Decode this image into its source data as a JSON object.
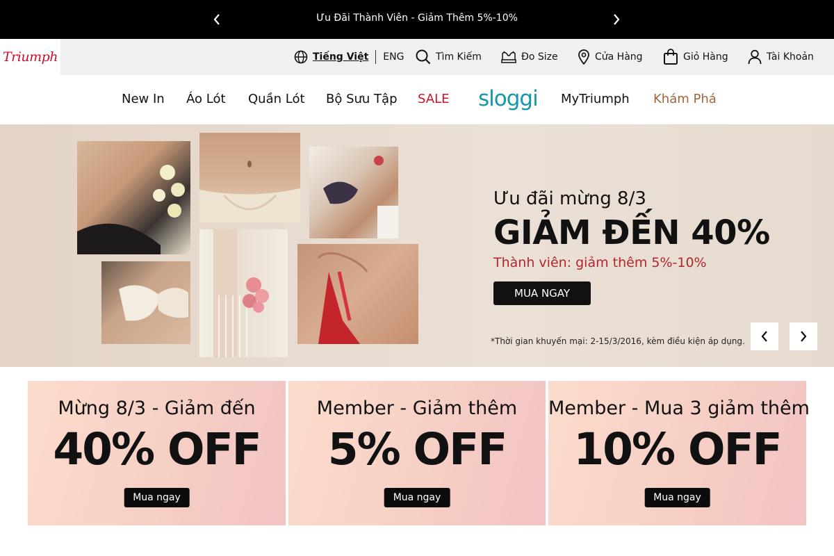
{
  "announcement": {
    "text": "Ưu Đãi Thành Viên - Giảm Thêm 5%-10%"
  },
  "brand": {
    "logo_text": "Triumph",
    "accent": "#c8102e"
  },
  "utility": {
    "lang_vi": "Tiếng Việt",
    "lang_en": "ENG",
    "search": "Tìm Kiếm",
    "size": "Đo Size",
    "stores": "Cửa Hàng",
    "cart": "Giỏ Hàng",
    "account": "Tài Khoản"
  },
  "nav": {
    "new_in": "New In",
    "bras": "Áo Lót",
    "panties": "Quần Lót",
    "collections": "Bộ Sưu Tập",
    "sale": "SALE",
    "sloggi": "sloggi",
    "mytriumph": "MyTriumph",
    "explore": "Khám Phá"
  },
  "hero": {
    "subtitle": "Ưu đãi mừng 8/3",
    "title": "GIẢM ĐẾN 40%",
    "member": "Thành viên: giảm thêm 5%-10%",
    "cta": "MUA NGAY",
    "note": "*Thời gian khuyến mại: 2-15/3/2016, kèm điều kiện áp dụng."
  },
  "promos": [
    {
      "title": "Mừng 8/3 - Giảm đến",
      "big": "40% OFF",
      "cta": "Mua ngay"
    },
    {
      "title": "Member - Giảm thêm",
      "big": "5% OFF",
      "cta": "Mua ngay"
    },
    {
      "title": "Member - Mua 3 giảm thêm",
      "big": "10% OFF",
      "cta": "Mua ngay"
    }
  ],
  "icons": {
    "announce_prev": "chevron-left-icon",
    "announce_next": "chevron-right-icon",
    "globe": "globe-icon",
    "search": "search-icon",
    "size": "bra-icon",
    "stores": "map-pin-icon",
    "cart": "shopping-bag-icon",
    "account": "user-icon"
  }
}
